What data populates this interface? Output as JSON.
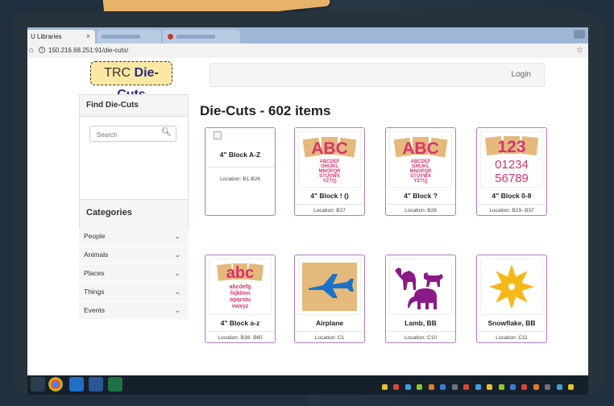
{
  "browser": {
    "tabs": [
      {
        "label": "U Libraries",
        "close": "×"
      },
      {
        "label": ""
      },
      {
        "label": ""
      }
    ],
    "url": "150.216.68.251:91/die-cuts/"
  },
  "site": {
    "logo_part1": "TRC",
    "logo_part2": "Die-Cuts",
    "login_label": "Login"
  },
  "sidebar": {
    "find_heading": "Find Die-Cuts",
    "search_placeholder": "Search",
    "categories_heading": "Categories",
    "categories": [
      {
        "label": "People"
      },
      {
        "label": "Animals"
      },
      {
        "label": "Places"
      },
      {
        "label": "Things"
      },
      {
        "label": "Events"
      }
    ]
  },
  "main": {
    "title": "Die-Cuts - 602 items",
    "items": [
      {
        "name": "4\" Block A-Z",
        "location": "Location: B1-B26",
        "image": "broken-image"
      },
      {
        "name": "4\" Block ! ()",
        "location": "Location: B27",
        "image": "abc-letters-uppercase"
      },
      {
        "name": "4\" Block ?",
        "location": "Location: B28",
        "image": "abc-letters-uppercase"
      },
      {
        "name": "4\" Block 0-8",
        "location": "Location: B29- B37",
        "image": "number-blocks"
      },
      {
        "name": "4\" Block a-z",
        "location": "Location: B38- B60",
        "image": "abc-letters-lowercase"
      },
      {
        "name": "Airplane",
        "location": "Location: C1",
        "image": "airplane"
      },
      {
        "name": "Lamb, BB",
        "location": "Location: C10",
        "image": "animal-silhouettes"
      },
      {
        "name": "Snowflake, BB",
        "location": "Location: C11",
        "image": "snowflake"
      }
    ],
    "thumb_text": {
      "abc_upper": "ABC",
      "abc_lower": "abc",
      "upper_lines": [
        "ABCDEF",
        "GHIJKL",
        "MNOPQR",
        "STUVWX",
        "YZ?!()"
      ],
      "lower_lines": [
        "abcdefg",
        "hijklmn",
        "opqrstu",
        "vwxyz"
      ],
      "num_top": "123",
      "num_lines": [
        "01234",
        "56789"
      ]
    }
  },
  "colors": {
    "card_border": "#b07cc0",
    "letter_red": "#d8336f",
    "block_tan": "#e5b97b",
    "plane_blue": "#1a73c8",
    "animal_purple": "#8b1a86",
    "snowflake_yellow": "#f5b71a"
  }
}
